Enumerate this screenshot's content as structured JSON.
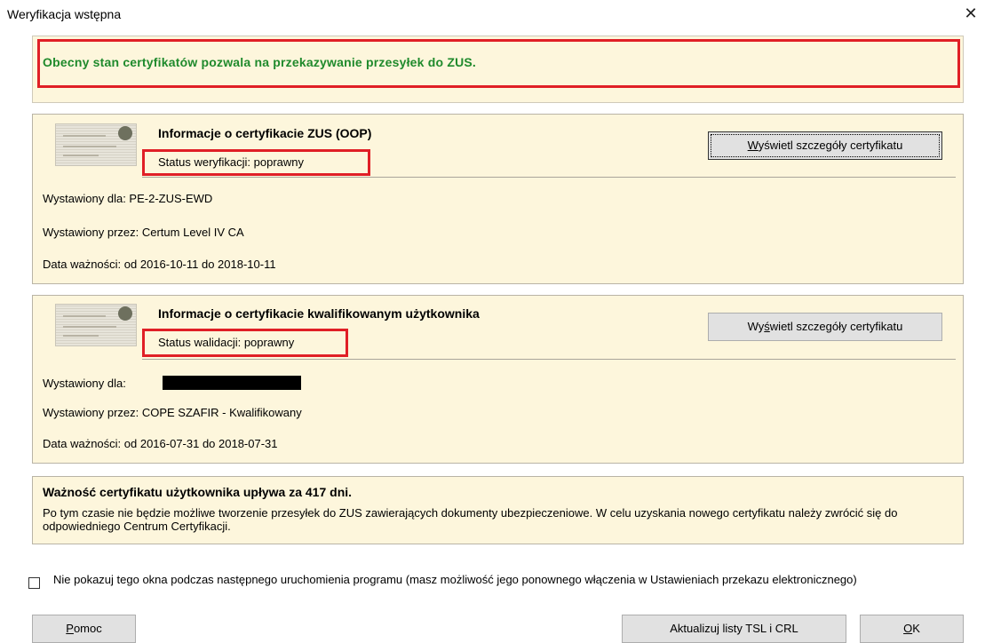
{
  "window": {
    "title": "Weryfikacja wstępna",
    "close_glyph": "✕"
  },
  "banner": {
    "message": "Obecny stan certyfikatów pozwala na przekazywanie przesyłek do ZUS."
  },
  "zus_cert": {
    "title": "Informacje o certyfikacie ZUS (OOP)",
    "status": "Status weryfikacji: poprawny",
    "button_mnemonic": "W",
    "button_rest": "yświetl szczegóły certyfikatu",
    "issued_for": "Wystawiony dla: PE-2-ZUS-EWD",
    "issued_by": "Wystawiony przez: Certum Level IV CA",
    "validity": "Data ważności: od 2016-10-11 do 2018-10-11"
  },
  "user_cert": {
    "title": "Informacje o certyfikacie kwalifikowanym użytkownika",
    "status": "Status walidacji: poprawny",
    "button_prefix": "Wy",
    "button_mnemonic": "ś",
    "button_rest": "wietl szczegóły certyfikatu",
    "issued_for": "Wystawiony dla:",
    "issued_by": "Wystawiony przez: COPE SZAFIR - Kwalifikowany",
    "validity": "Data ważności: od 2016-07-31 do 2018-07-31"
  },
  "expiry": {
    "title": "Ważność certyfikatu użytkownika upływa za 417 dni.",
    "text": "Po tym czasie nie będzie możliwe tworzenie przesyłek do ZUS zawierających dokumenty ubezpieczeniowe. W celu uzyskania nowego certyfikatu należy zwrócić się do odpowiedniego Centrum Certyfikacji."
  },
  "checkbox": {
    "checked": false,
    "label": "Nie pokazuj tego okna podczas następnego uruchomienia programu (masz możliwość jego ponownego włączenia w Ustawieniach przekazu elektronicznego)"
  },
  "footer": {
    "help_mnemonic": "P",
    "help_rest": "omoc",
    "update_label": "Aktualizuj listy TSL i CRL",
    "ok_mnemonic": "O",
    "ok_rest": "K"
  },
  "colors": {
    "banner_text": "#1f8a2c",
    "highlight": "#e01f26",
    "panel_bg": "#fdf6dc"
  }
}
